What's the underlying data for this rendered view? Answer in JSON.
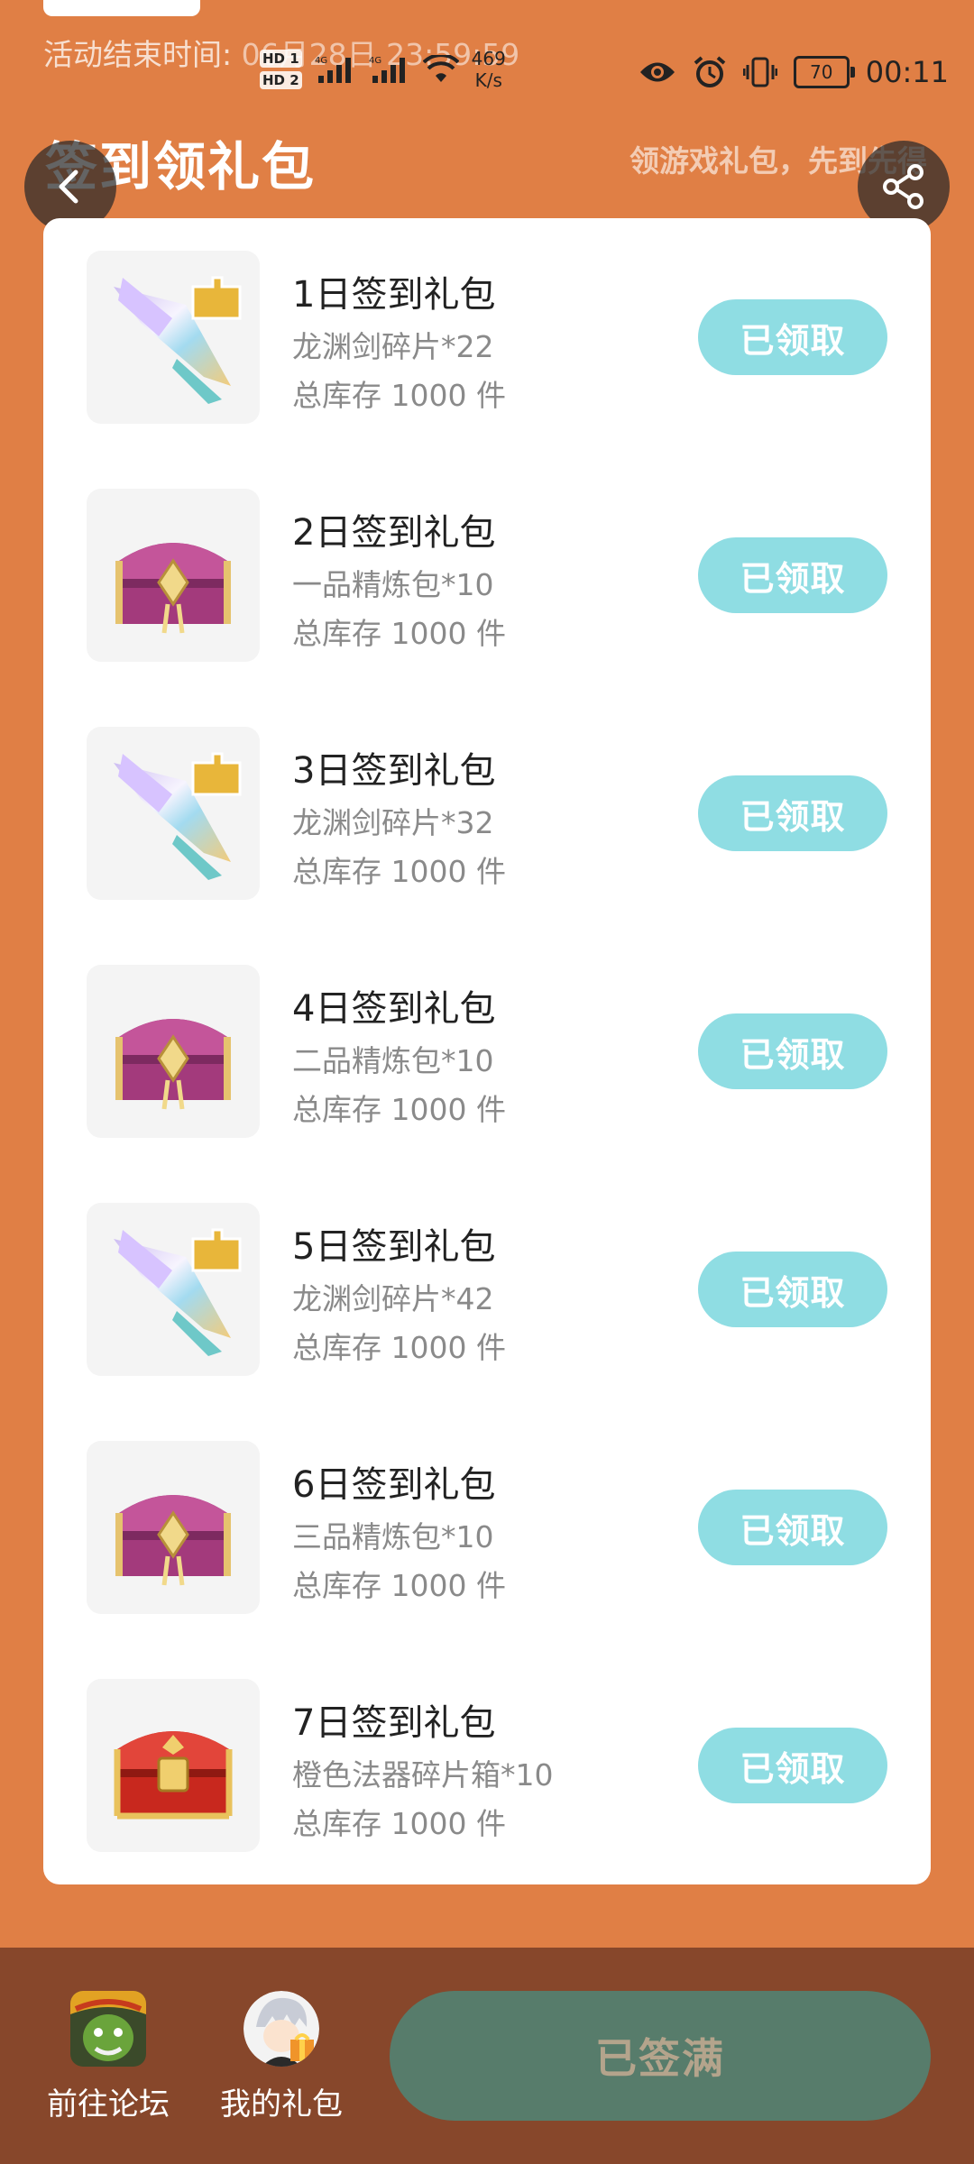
{
  "status_bar": {
    "activity_end_label": "活动结束时间: ",
    "activity_end_time": "06月28日 23:59:59",
    "hd1": "HD 1",
    "hd2": "HD 2",
    "net_type_1": "4G",
    "net_type_2": "4G",
    "net_speed_value": "469",
    "net_speed_unit": "K/s",
    "battery": "70",
    "time": "00:11"
  },
  "header": {
    "title": "签到领礼包",
    "slogan": "领游戏礼包，先到先得"
  },
  "gifts": [
    {
      "title": "1日签到礼包",
      "desc": "龙渊剑碎片*22",
      "stock": "总库存 1000 件",
      "button": "已领取",
      "icon": "sword-shard-icon"
    },
    {
      "title": "2日签到礼包",
      "desc": "一品精炼包*10",
      "stock": "总库存 1000 件",
      "button": "已领取",
      "icon": "purple-chest-icon"
    },
    {
      "title": "3日签到礼包",
      "desc": "龙渊剑碎片*32",
      "stock": "总库存 1000 件",
      "button": "已领取",
      "icon": "sword-shard-icon"
    },
    {
      "title": "4日签到礼包",
      "desc": "二品精炼包*10",
      "stock": "总库存 1000 件",
      "button": "已领取",
      "icon": "purple-chest-icon"
    },
    {
      "title": "5日签到礼包",
      "desc": "龙渊剑碎片*42",
      "stock": "总库存 1000 件",
      "button": "已领取",
      "icon": "sword-shard-icon"
    },
    {
      "title": "6日签到礼包",
      "desc": "三品精炼包*10",
      "stock": "总库存 1000 件",
      "button": "已领取",
      "icon": "purple-chest-icon"
    },
    {
      "title": "7日签到礼包",
      "desc": "橙色法器碎片箱*10",
      "stock": "总库存 1000 件",
      "button": "已领取",
      "icon": "red-chest-icon"
    }
  ],
  "bottom_bar": {
    "forum_label": "前往论坛",
    "my_gifts_label": "我的礼包",
    "signed_button": "已签满"
  },
  "colors": {
    "page_bg": "#e07f45",
    "claimed_button": "#8fdde3",
    "bottom_bar": "#87472b",
    "signed_button": "#577c6b"
  }
}
